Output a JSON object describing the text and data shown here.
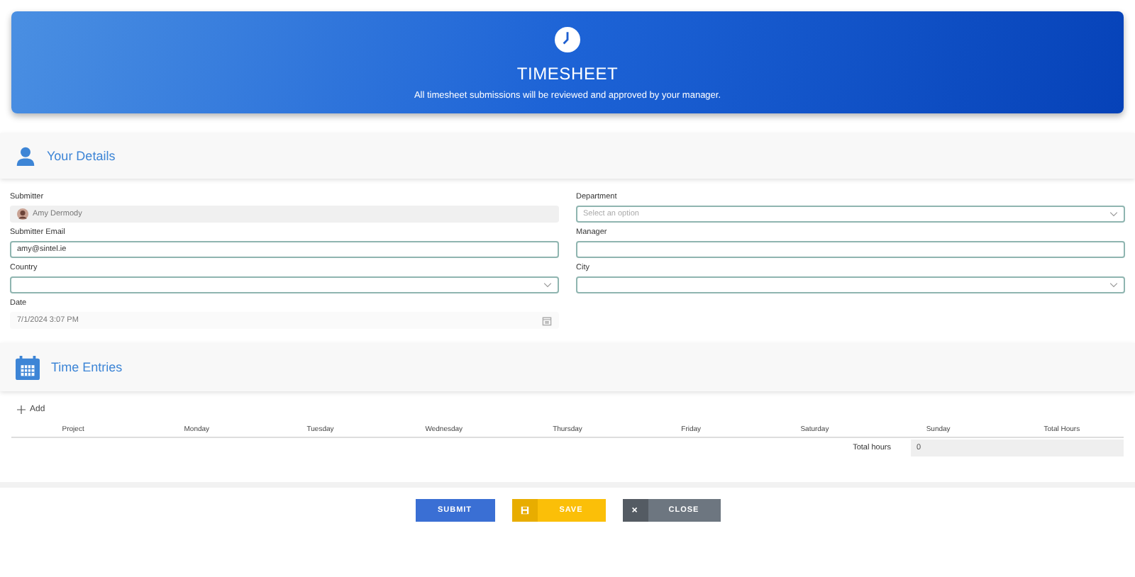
{
  "header": {
    "title": "TIMESHEET",
    "subtitle": "All timesheet submissions will be reviewed and approved by your manager."
  },
  "details": {
    "title": "Your Details",
    "left": [
      {
        "kind": "person",
        "label": "Submitter",
        "value": "Amy Dermody",
        "disabled": true
      },
      {
        "kind": "text",
        "label": "Submitter Email",
        "value": "amy@sintel.ie",
        "disabled": false
      },
      {
        "kind": "select",
        "label": "Country",
        "disabled": false
      },
      {
        "kind": "date",
        "label": "Date",
        "value": "7/1/2024 3:07 PM",
        "disabled": true
      }
    ],
    "right": [
      {
        "kind": "select",
        "label": "Department",
        "placeholder": "Select an option",
        "disabled": false
      },
      {
        "kind": "text",
        "label": "Manager",
        "disabled": false
      },
      {
        "kind": "select",
        "label": "City",
        "disabled": false
      }
    ]
  },
  "entries": {
    "title": "Time Entries",
    "add": "Add",
    "columns": [
      "Project",
      "Monday",
      "Tuesday",
      "Wednesday",
      "Thursday",
      "Friday",
      "Saturday",
      "Sunday",
      "Total Hours"
    ],
    "total_label": "Total hours",
    "total_value": "0"
  },
  "buttons": [
    {
      "kind": "primary",
      "label": "SUBMIT"
    },
    {
      "kind": "save",
      "label": "SAVE"
    },
    {
      "kind": "close",
      "label": "CLOSE",
      "icon": "×"
    }
  ]
}
